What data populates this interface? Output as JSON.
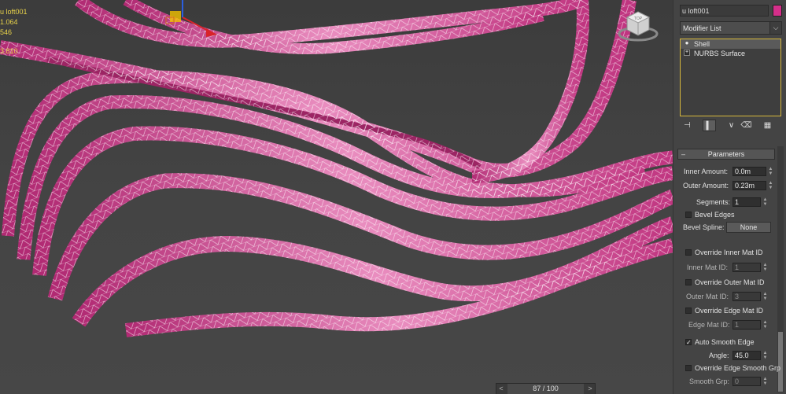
{
  "viewport": {
    "stats": [
      "u loft001",
      "1.064",
      "546",
      "3.810"
    ],
    "viewcube_label": "TOP",
    "time_slider": {
      "prev": "<",
      "frame": "87 / 100",
      "next": ">"
    }
  },
  "panel": {
    "object_name": "u loft001",
    "object_color": "#d52f8a",
    "modifier_list": "Modifier List",
    "stack": [
      {
        "label": "Shell",
        "selected": true
      },
      {
        "label": "NURBS Surface",
        "selected": false
      }
    ],
    "tools": [
      "pin-stack",
      "show-end-result",
      "make-unique",
      "remove-modifier",
      "configure-modifier-sets"
    ],
    "rollout": {
      "title": "Parameters",
      "inner_amount_label": "Inner Amount:",
      "inner_amount": "0.0m",
      "outer_amount_label": "Outer Amount:",
      "outer_amount": "0.23m",
      "segments_label": "Segments:",
      "segments": "1",
      "bevel_edges_label": "Bevel Edges",
      "bevel_spline_label": "Bevel Spline:",
      "bevel_spline_button": "None",
      "override_inner_label": "Override Inner Mat ID",
      "inner_mat_label": "Inner Mat ID:",
      "inner_mat": "1",
      "override_outer_label": "Override Outer Mat ID",
      "outer_mat_label": "Outer Mat ID:",
      "outer_mat": "3",
      "override_edge_label": "Override Edge Mat ID",
      "edge_mat_label": "Edge Mat ID:",
      "edge_mat": "1",
      "auto_smooth_label": "Auto Smooth Edge",
      "angle_label": "Angle:",
      "angle": "45.0",
      "override_smooth_label": "Override Edge Smooth Grp",
      "smooth_grp_label": "Smooth Grp:",
      "smooth_grp": "0"
    }
  },
  "colors": {
    "ribbon": "#c2357f",
    "ribbon_light": "#e89ac4",
    "accent": "#e8d24a"
  }
}
